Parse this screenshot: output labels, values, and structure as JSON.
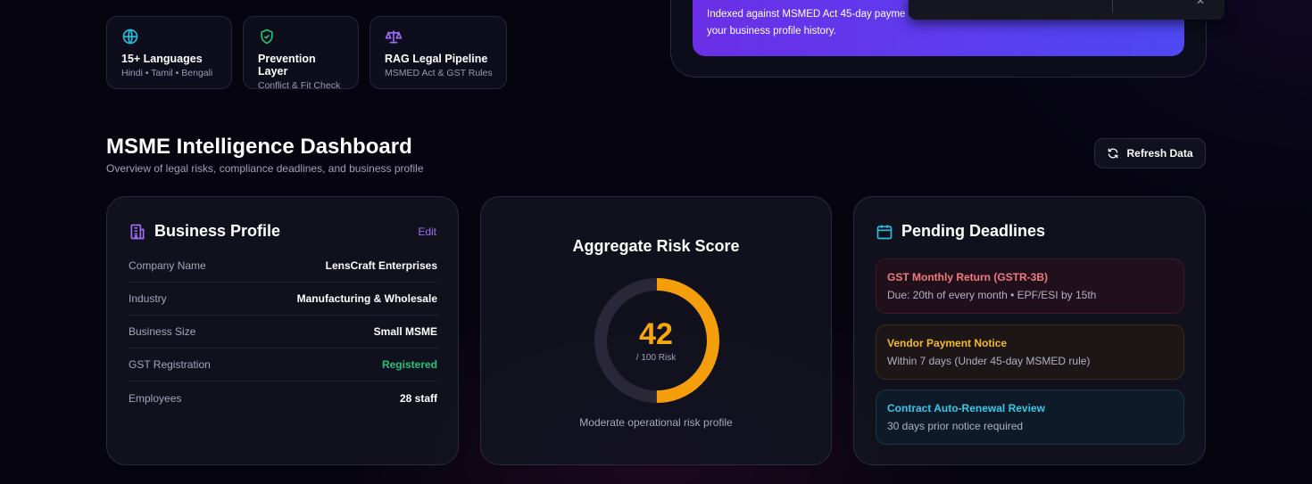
{
  "features": [
    {
      "title": "15+ Languages",
      "subtitle": "Hindi • Tamil • Bengali",
      "icon": "globe-icon"
    },
    {
      "title": "Prevention Layer",
      "subtitle": "Conflict & Fit Check",
      "icon": "shield-check-icon"
    },
    {
      "title": "RAG Legal Pipeline",
      "subtitle": "MSMED Act & GST Rules",
      "icon": "scale-icon"
    }
  ],
  "rag_banner": {
    "line1": "Indexed against MSMED Act 45-day payme",
    "line2": "your business profile history."
  },
  "toast": {
    "close": "✕"
  },
  "dashboard": {
    "title": "MSME Intelligence Dashboard",
    "subtitle": "Overview of legal risks, compliance deadlines, and business profile",
    "refresh_label": "Refresh Data"
  },
  "profile": {
    "title": "Business Profile",
    "edit_label": "Edit",
    "rows": [
      {
        "key": "Company Name",
        "value": "LensCraft Enterprises"
      },
      {
        "key": "Industry",
        "value": "Manufacturing & Wholesale"
      },
      {
        "key": "Business Size",
        "value": "Small MSME"
      },
      {
        "key": "GST Registration",
        "value": "Registered"
      },
      {
        "key": "Employees",
        "value": "28 staff"
      }
    ]
  },
  "risk": {
    "title": "Aggregate Risk Score",
    "score": "42",
    "score_fraction": 0.5,
    "unit": "/ 100 Risk",
    "description": "Moderate operational risk profile",
    "colors": {
      "fill": "#f59e0b",
      "track": "#2a2838",
      "score_text": "#f5a70b"
    }
  },
  "deadlines": {
    "title": "Pending Deadlines",
    "items": [
      {
        "title": "GST Monthly Return (GSTR-3B)",
        "detail": "Due: 20th of every month • EPF/ESI by 15th"
      },
      {
        "title": "Vendor Payment Notice",
        "detail": "Within 7 days (Under 45-day MSMED rule)"
      },
      {
        "title": "Contract Auto-Renewal Review",
        "detail": "30 days prior notice required"
      }
    ]
  },
  "colors": {
    "background": "#05040f",
    "accent_purple": "#a06cf0",
    "success_green": "#22c27a",
    "deadline_red": "#f07a80",
    "deadline_amber": "#f5b829",
    "deadline_cyan": "#37c8e8"
  }
}
